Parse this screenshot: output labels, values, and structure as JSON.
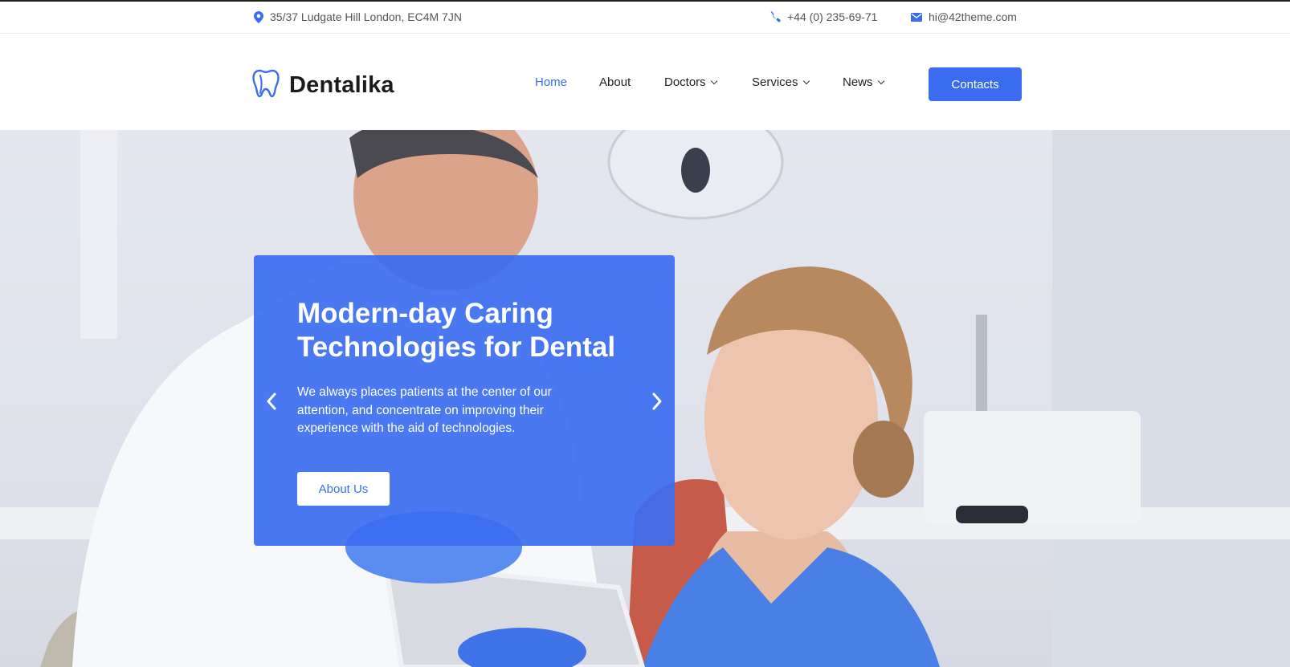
{
  "topbar": {
    "address": "35/37 Ludgate Hill London, EC4M 7JN",
    "phone": "+44 (0) 235-69-71",
    "email": "hi@42theme.com"
  },
  "brand": {
    "name": "Dentalika",
    "accent_color": "#3b6cf0"
  },
  "nav": {
    "items": [
      {
        "label": "Home",
        "active": true,
        "dropdown": false
      },
      {
        "label": "About",
        "active": false,
        "dropdown": false
      },
      {
        "label": "Doctors",
        "active": false,
        "dropdown": true
      },
      {
        "label": "Services",
        "active": false,
        "dropdown": true
      },
      {
        "label": "News",
        "active": false,
        "dropdown": true
      }
    ],
    "cta_label": "Contacts"
  },
  "hero": {
    "title": "Modern-day Caring Technologies for Dental",
    "text": "We always places patients at the center of our attention, and concentrate on improving their experience with the aid of technologies.",
    "button_label": "About Us",
    "prev_icon": "chevron-left-icon",
    "next_icon": "chevron-right-icon"
  }
}
